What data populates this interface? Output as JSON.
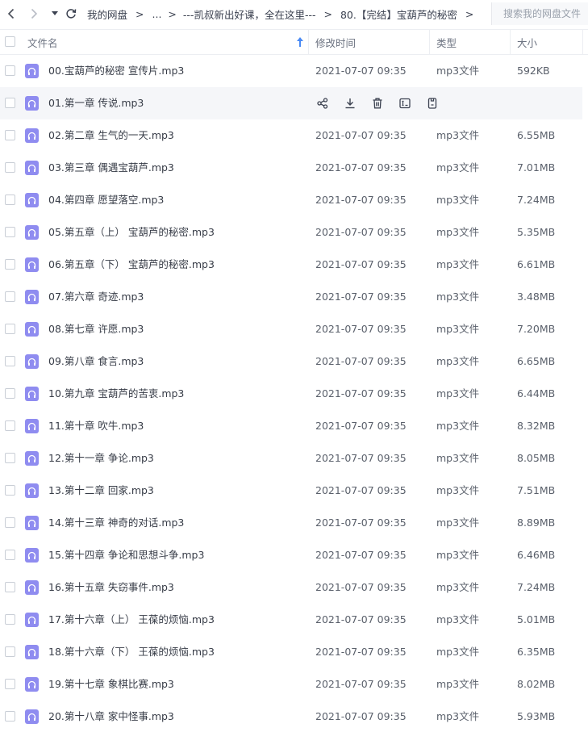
{
  "nav": {
    "breadcrumbs": [
      "我的网盘",
      "...",
      "---凯叔新出好课，全在这里---",
      "80.【完结】宝葫芦的秘密"
    ],
    "separator": ">"
  },
  "search": {
    "placeholder": "搜索我的网盘文件"
  },
  "columns": {
    "name": "文件名",
    "modified": "修改时间",
    "type": "类型",
    "size": "大小"
  },
  "files": [
    {
      "name": "00.宝葫芦的秘密 宣传片.mp3",
      "modified": "2021-07-07 09:35",
      "type": "mp3文件",
      "size": "592KB"
    },
    {
      "name": "01.第一章 传说.mp3",
      "modified": "2021-07-07 09:35",
      "type": "mp3文件",
      "size": "6.52MB",
      "hovered": true
    },
    {
      "name": "02.第二章 生气的一天.mp3",
      "modified": "2021-07-07 09:35",
      "type": "mp3文件",
      "size": "6.55MB"
    },
    {
      "name": "03.第三章 偶遇宝葫芦.mp3",
      "modified": "2021-07-07 09:35",
      "type": "mp3文件",
      "size": "7.01MB"
    },
    {
      "name": "04.第四章 愿望落空.mp3",
      "modified": "2021-07-07 09:35",
      "type": "mp3文件",
      "size": "7.24MB"
    },
    {
      "name": "05.第五章（上） 宝葫芦的秘密.mp3",
      "modified": "2021-07-07 09:35",
      "type": "mp3文件",
      "size": "5.35MB"
    },
    {
      "name": "06.第五章（下） 宝葫芦的秘密.mp3",
      "modified": "2021-07-07 09:35",
      "type": "mp3文件",
      "size": "6.61MB"
    },
    {
      "name": "07.第六章 奇迹.mp3",
      "modified": "2021-07-07 09:35",
      "type": "mp3文件",
      "size": "3.48MB"
    },
    {
      "name": "08.第七章 许愿.mp3",
      "modified": "2021-07-07 09:35",
      "type": "mp3文件",
      "size": "7.20MB"
    },
    {
      "name": "09.第八章 食言.mp3",
      "modified": "2021-07-07 09:35",
      "type": "mp3文件",
      "size": "6.65MB"
    },
    {
      "name": "10.第九章 宝葫芦的苦衷.mp3",
      "modified": "2021-07-07 09:35",
      "type": "mp3文件",
      "size": "6.44MB"
    },
    {
      "name": "11.第十章 吹牛.mp3",
      "modified": "2021-07-07 09:35",
      "type": "mp3文件",
      "size": "8.32MB"
    },
    {
      "name": "12.第十一章 争论.mp3",
      "modified": "2021-07-07 09:35",
      "type": "mp3文件",
      "size": "8.05MB"
    },
    {
      "name": "13.第十二章 回家.mp3",
      "modified": "2021-07-07 09:35",
      "type": "mp3文件",
      "size": "7.51MB"
    },
    {
      "name": "14.第十三章 神奇的对话.mp3",
      "modified": "2021-07-07 09:35",
      "type": "mp3文件",
      "size": "8.89MB"
    },
    {
      "name": "15.第十四章 争论和思想斗争.mp3",
      "modified": "2021-07-07 09:35",
      "type": "mp3文件",
      "size": "6.46MB"
    },
    {
      "name": "16.第十五章 失窃事件.mp3",
      "modified": "2021-07-07 09:35",
      "type": "mp3文件",
      "size": "7.24MB"
    },
    {
      "name": "17.第十六章（上） 王葆的烦恼.mp3",
      "modified": "2021-07-07 09:35",
      "type": "mp3文件",
      "size": "5.01MB"
    },
    {
      "name": "18.第十六章（下） 王葆的烦恼.mp3",
      "modified": "2021-07-07 09:35",
      "type": "mp3文件",
      "size": "6.35MB"
    },
    {
      "name": "19.第十七章 象棋比赛.mp3",
      "modified": "2021-07-07 09:35",
      "type": "mp3文件",
      "size": "8.02MB"
    },
    {
      "name": "20.第十八章 家中怪事.mp3",
      "modified": "2021-07-07 09:35",
      "type": "mp3文件",
      "size": "5.93MB"
    }
  ],
  "row_actions": [
    "share-icon",
    "download-icon",
    "delete-icon",
    "rename-icon",
    "more-icon"
  ],
  "colors": {
    "file_icon": "#8f8cf0",
    "hover_row": "#f5f6f9",
    "sort_arrow": "#4a8af4"
  }
}
